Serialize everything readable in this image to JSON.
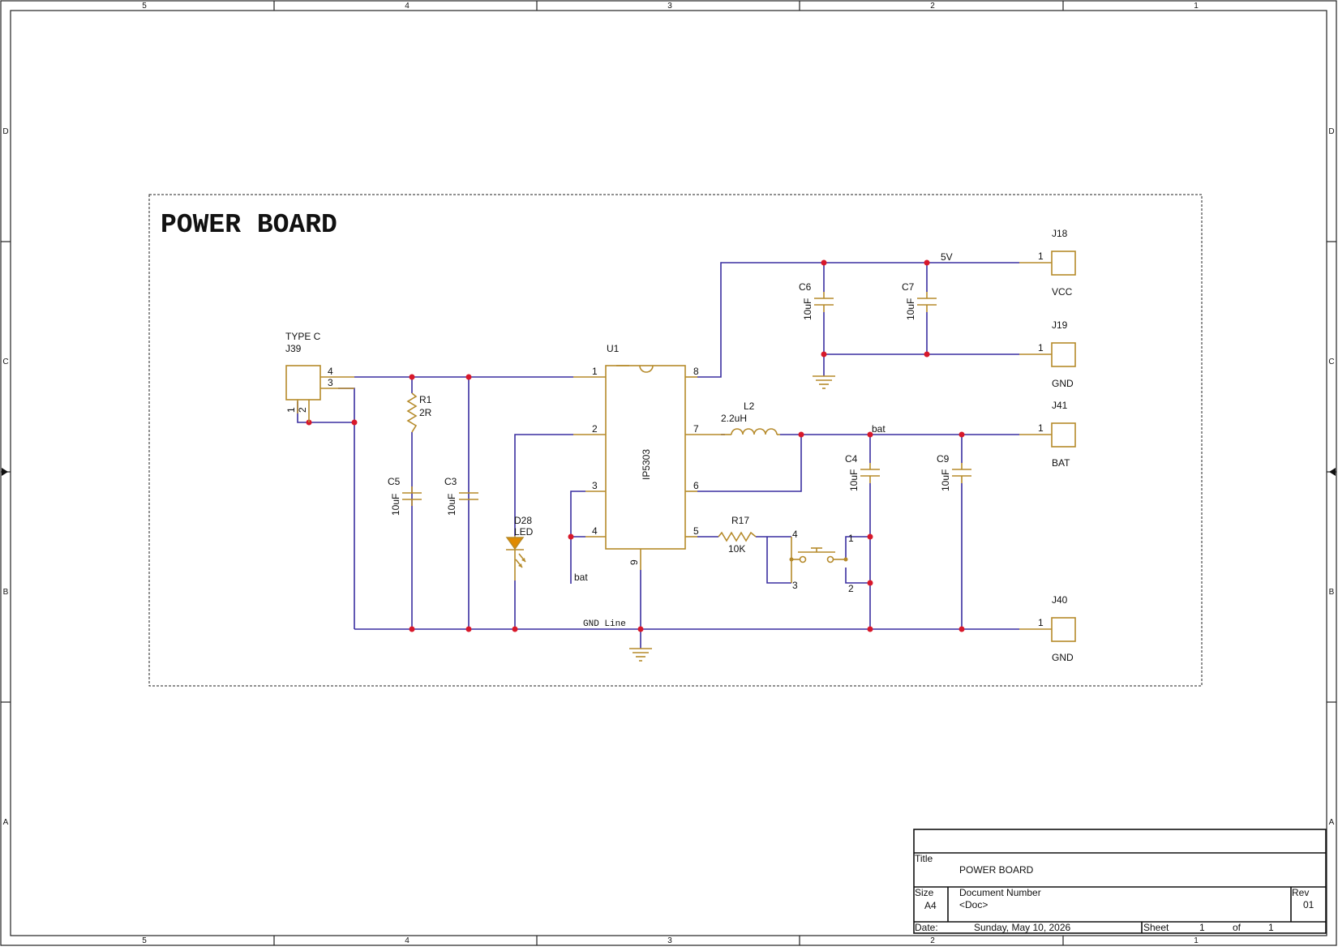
{
  "zones": {
    "columns": [
      "5",
      "4",
      "3",
      "2",
      "1"
    ],
    "rows": [
      "D",
      "C",
      "B",
      "A"
    ]
  },
  "schematic": {
    "heading": "POWER BOARD",
    "ic": {
      "ref": "U1",
      "part": "IP5303",
      "pins": [
        "1",
        "2",
        "3",
        "4",
        "5",
        "6",
        "7",
        "8",
        "9"
      ]
    },
    "usb": {
      "type": "TYPE C",
      "ref": "J39",
      "pins": [
        "4",
        "3",
        "1",
        "2"
      ]
    },
    "resistors": [
      {
        "ref": "R1",
        "value": "2R"
      },
      {
        "ref": "R17",
        "value": "10K"
      }
    ],
    "capacitors": [
      {
        "ref": "C5",
        "value": "10uF"
      },
      {
        "ref": "C3",
        "value": "10uF"
      },
      {
        "ref": "C6",
        "value": "10uF"
      },
      {
        "ref": "C7",
        "value": "10uF"
      },
      {
        "ref": "C4",
        "value": "10uF"
      },
      {
        "ref": "C9",
        "value": "10uF"
      }
    ],
    "inductor": {
      "ref": "L2",
      "value": "2.2uH"
    },
    "led": {
      "ref": "D28",
      "value": "LED"
    },
    "switch": {
      "pins": [
        "4",
        "3",
        "1",
        "2"
      ]
    },
    "connectors": [
      {
        "ref": "J18",
        "pin": "1",
        "label": "VCC"
      },
      {
        "ref": "J19",
        "pin": "1",
        "label": "GND"
      },
      {
        "ref": "J41",
        "pin": "1",
        "label": "BAT"
      },
      {
        "ref": "J40",
        "pin": "1",
        "label": "GND"
      }
    ],
    "net_labels": {
      "vout": "5V",
      "bat_top": "bat",
      "bat_left": "bat",
      "gnd_line": "GND Line"
    }
  },
  "title_block": {
    "title_label": "Title",
    "title": "POWER BOARD",
    "size_label": "Size",
    "size": "A4",
    "doc_label": "Document Number",
    "doc": "<Doc>",
    "rev_label": "Rev",
    "rev": "01",
    "date_label": "Date:",
    "date": "Sunday, May 10, 2026",
    "sheet_label": "Sheet",
    "sheet": "1",
    "of_label": "of",
    "total": "1"
  },
  "colors": {
    "wire": "#3a2fa0",
    "component": "#b58a2a",
    "junction": "#d8182a",
    "led_fill": "#e08a00"
  }
}
